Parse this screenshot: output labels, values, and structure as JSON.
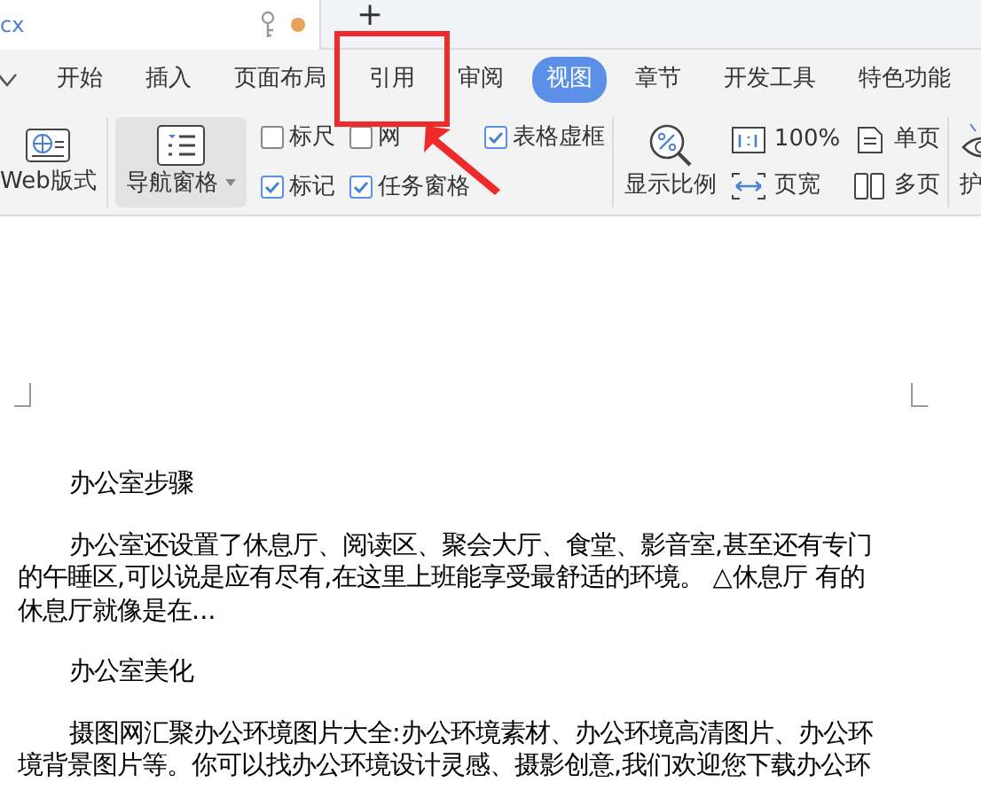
{
  "document_tab": {
    "title": "cx",
    "modified": true
  },
  "new_tab_button": "+",
  "ribbon_tabs": [
    {
      "label": "开始",
      "selected": false
    },
    {
      "label": "插入",
      "selected": false
    },
    {
      "label": "页面布局",
      "selected": false
    },
    {
      "label": "引用",
      "selected": false,
      "highlighted": true
    },
    {
      "label": "审阅",
      "selected": false
    },
    {
      "label": "视图",
      "selected": true
    },
    {
      "label": "章节",
      "selected": false
    },
    {
      "label": "开发工具",
      "selected": false
    },
    {
      "label": "特色功能",
      "selected": false
    }
  ],
  "toolbar": {
    "web_layout": "Web版式",
    "navigation_pane": "导航窗格",
    "checkboxes": [
      {
        "label": "标尺",
        "checked": false
      },
      {
        "label": "网",
        "checked": false
      },
      {
        "label": "表格虚框",
        "checked": true
      },
      {
        "label": "标记",
        "checked": true
      },
      {
        "label": "任务窗格",
        "checked": true
      }
    ],
    "zoom": "显示比例",
    "actual_size": "100%",
    "page_width": "页宽",
    "single_page": "单页",
    "multi_page": "多页",
    "eye_protection": "护"
  },
  "document": {
    "paragraphs": [
      {
        "lines": [
          "办公室步骤"
        ]
      },
      {
        "lines": [
          "办公室还设置了休息厅、阅读区、聚会大厅、食堂、影音室,甚至还有专门",
          "的午睡区,可以说是应有尽有,在这里上班能享受最舒适的环境。 △休息厅 有的",
          "休息厅就像是在..."
        ]
      },
      {
        "lines": [
          "办公室美化"
        ]
      },
      {
        "lines": [
          "摄图网汇聚办公环境图片大全:办公环境素材、办公环境高清图片、办公环",
          "境背景图片等。你可以找办公环境设计灵感、摄影创意,我们欢迎您下载办公环"
        ]
      }
    ]
  }
}
